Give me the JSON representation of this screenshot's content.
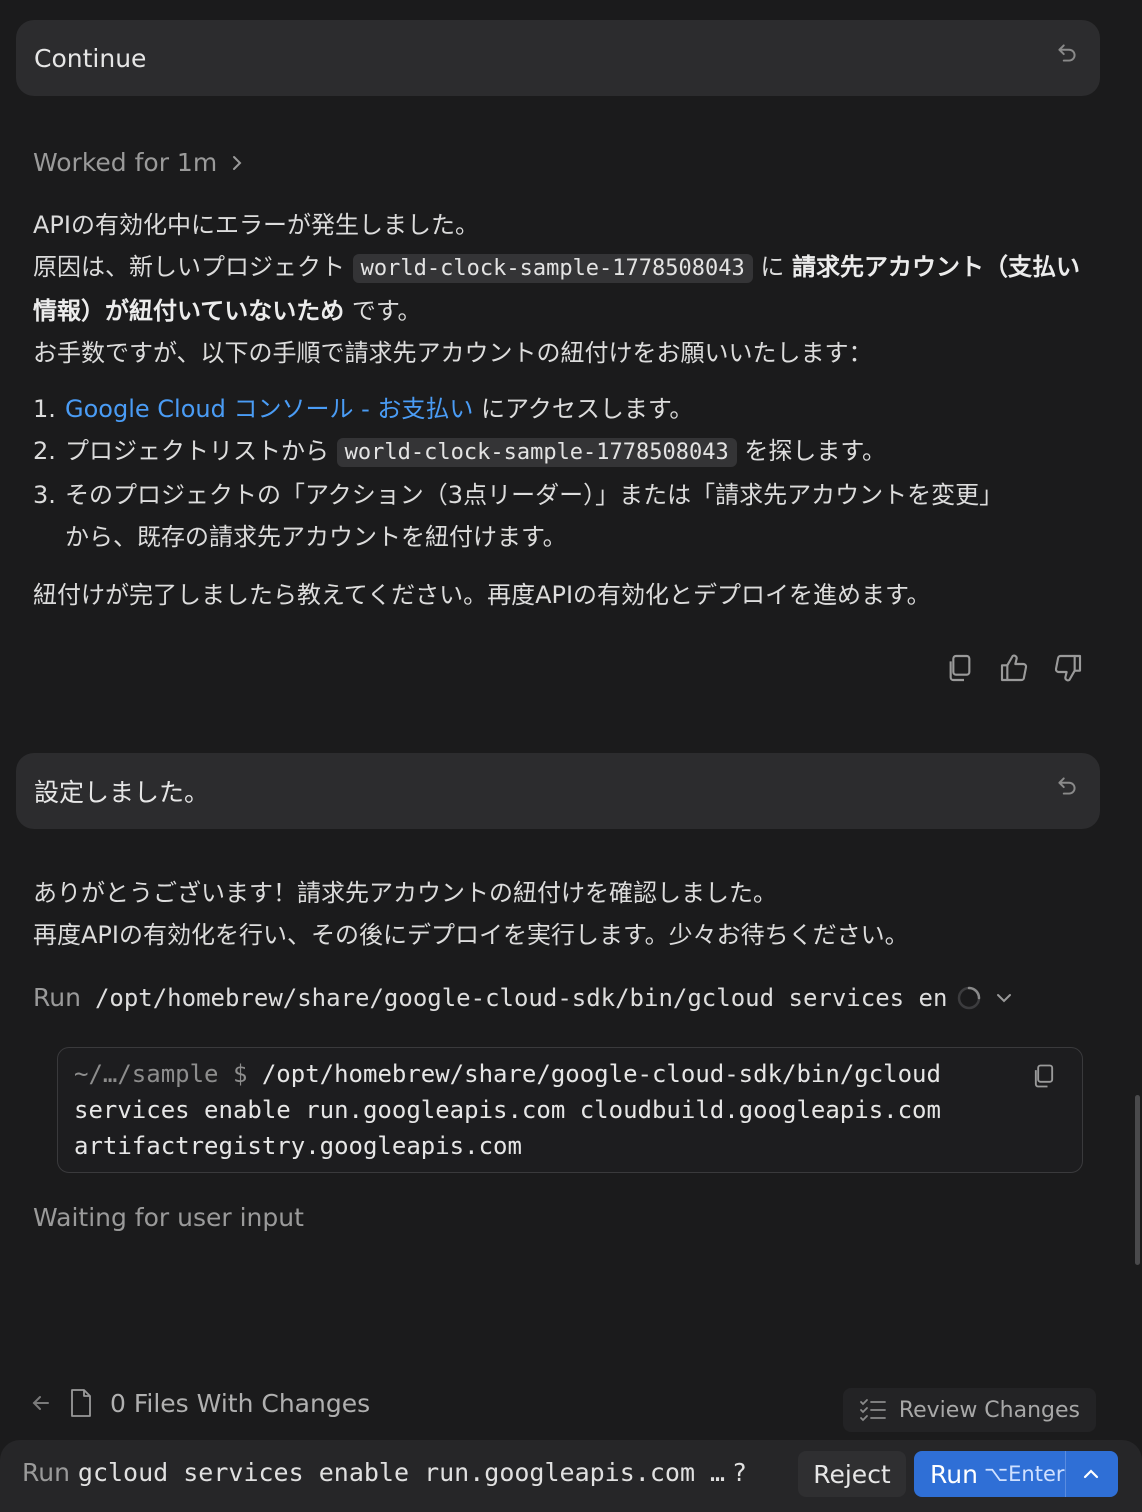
{
  "messages": {
    "user1": "Continue",
    "user2": "設定しました。"
  },
  "worked": {
    "label": "Worked for 1m"
  },
  "assistant1": {
    "line1": "APIの有効化中にエラーが発生しました。",
    "line2_pre": "原因は、新しいプロジェクト",
    "project_code": "world-clock-sample-1778508043",
    "line2_mid": "に",
    "line2_bold": "請求先アカウント（支払い情報）が紐付いていないため",
    "line2_post": "です。",
    "line3": "お手数ですが、以下の手順で請求先アカウントの紐付けをお願いいたします：",
    "steps": {
      "s1_num": "1.",
      "s1_link": "Google Cloud コンソール - お支払い",
      "s1_post": "にアクセスします。",
      "s2_num": "2.",
      "s2_pre": "プロジェクトリストから",
      "s2_code": "world-clock-sample-1778508043",
      "s2_post": "を探します。",
      "s3_num": "3.",
      "s3_line1": "そのプロジェクトの「アクション（3点リーダー）」または「請求先アカウントを変更」",
      "s3_line2": "から、既存の請求先アカウントを紐付けます。"
    },
    "closing": "紐付けが完了しましたら教えてください。再度APIの有効化とデプロイを進めます。"
  },
  "assistant2": {
    "line1": "ありがとうございます！請求先アカウントの紐付けを確認しました。",
    "line2": "再度APIの有効化を行い、その後にデプロイを実行します。少々お待ちください。"
  },
  "run_step": {
    "label": "Run",
    "command": "/opt/homebrew/share/google-cloud-sdk/bin/gcloud services en"
  },
  "terminal": {
    "prompt": "~/…/sample $",
    "line1": "/opt/homebrew/share/google-cloud-sdk/bin/gcloud",
    "line2": "services enable run.googleapis.com cloudbuild.googleapis.com",
    "line3": "artifactregistry.googleapis.com"
  },
  "status": "Waiting for user input",
  "footer": {
    "files_label": "0 Files With Changes",
    "review_label": "Review Changes"
  },
  "action_bar": {
    "run_prefix": "Run",
    "command": "gcloud services enable run.googleapis.com …",
    "question": "?",
    "reject": "Reject",
    "run": "Run",
    "shortcut": "⌥Enter"
  },
  "colors": {
    "background": "#1b1b1c",
    "bubble": "#2c2c2e",
    "link": "#4a9cf5",
    "run_button": "#2f6fd6"
  }
}
